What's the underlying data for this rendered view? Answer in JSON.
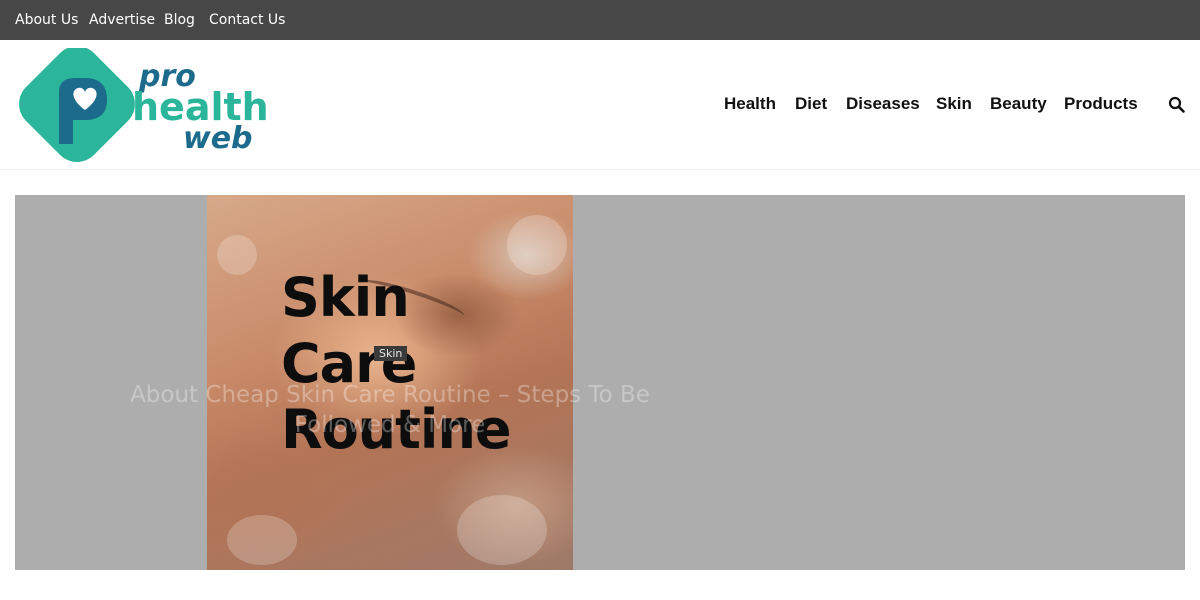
{
  "topbar": {
    "links": [
      "About Us",
      "Advertise",
      "Blog",
      "Contact Us"
    ]
  },
  "logo": {
    "text": "pro health web",
    "colors": {
      "teal": "#2bb59a",
      "navy": "#1d6b8c"
    }
  },
  "nav": {
    "items": [
      "Health",
      "Diet",
      "Diseases",
      "Skin",
      "Beauty",
      "Products"
    ],
    "search_icon": "search-icon"
  },
  "featured": {
    "image_text": [
      "Skin",
      "Care",
      "Routine"
    ],
    "category": "Skin",
    "title": "About Cheap Skin Care Routine – Steps To Be Followed & More"
  },
  "colors": {
    "topbar_bg": "#474747",
    "placeholder_gray": "#adadad"
  }
}
